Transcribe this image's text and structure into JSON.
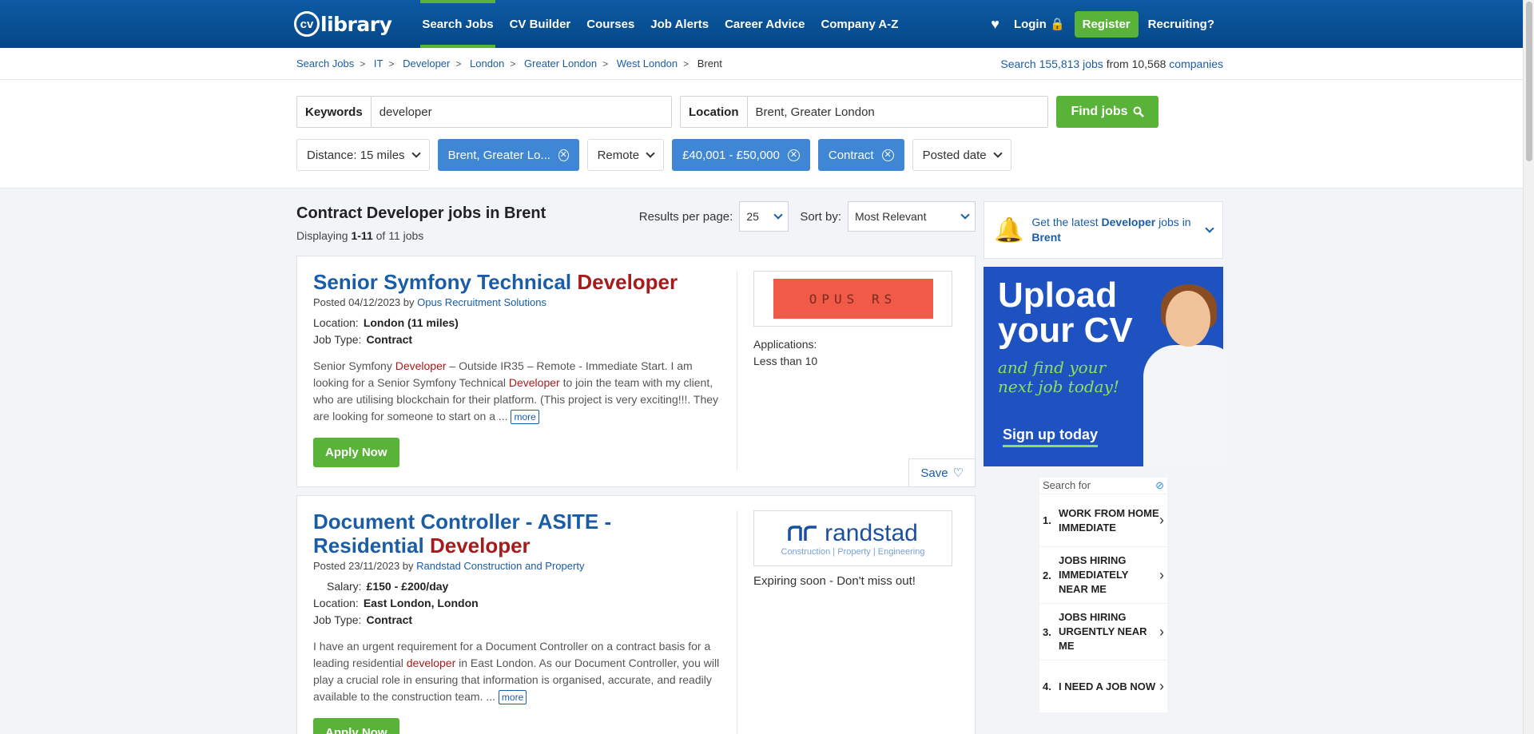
{
  "header": {
    "logo_cv": "cv",
    "logo_library": "library",
    "nav": [
      "Search Jobs",
      "CV Builder",
      "Courses",
      "Job Alerts",
      "Career Advice",
      "Company A-Z"
    ],
    "login": "Login",
    "register": "Register",
    "recruiting": "Recruiting?"
  },
  "breadcrumb": [
    "Search Jobs",
    "IT",
    "Developer",
    "London",
    "Greater London",
    "West London"
  ],
  "breadcrumb_current": "Brent",
  "stats": {
    "prefix": "Search",
    "jobs": "155,813 jobs",
    "from": "from 10,568",
    "companies": "companies"
  },
  "search": {
    "keywords_label": "Keywords",
    "keywords_value": "developer",
    "location_label": "Location",
    "location_value": "Brent, Greater London",
    "find_label": "Find jobs"
  },
  "filters": {
    "distance": "Distance: 15 miles",
    "location": "Brent, Greater Lo...",
    "remote": "Remote",
    "salary": "£40,001 - £50,000",
    "type": "Contract",
    "posted": "Posted date"
  },
  "results": {
    "title": "Contract Developer jobs in Brent",
    "displaying": "Displaying",
    "range": "1-11",
    "of": "of 11 jobs",
    "per_page_label": "Results per page:",
    "per_page": "25",
    "sort_label": "Sort by:",
    "sort": "Most Relevant"
  },
  "jobs": [
    {
      "title_a": "Senior Symfony Technical",
      "title_hl": "Developer",
      "posted": "Posted 04/12/2023 by",
      "company": "Opus Recruitment Solutions",
      "location_label": "Location:",
      "location": "London (11 miles)",
      "type_label": "Job Type:",
      "type": "Contract",
      "desc_1": "Senior Symfony",
      "desc_hl1": "Developer",
      "desc_2": " – Outside IR35 – Remote - Immediate Start. I am looking for a Senior Symfony Technical",
      "desc_hl2": "Developer",
      "desc_3": " to join the team with my client, who are utilising blockchain for their platform. (This project is very exciting!!!. They are looking for someone to start on a ...",
      "more": "more",
      "apply": "Apply Now",
      "logo": "OPUS RS",
      "applications_label": "Applications:",
      "applications": "Less than 10",
      "save": "Save"
    },
    {
      "title_a": "Document Controller - ASITE - Residential",
      "title_hl": "Developer",
      "posted": "Posted 23/11/2023 by",
      "company": "Randstad Construction and Property",
      "salary_label": "Salary:",
      "salary": "£150 - £200/day",
      "location_label": "Location:",
      "location": "East London, London",
      "type_label": "Job Type:",
      "type": "Contract",
      "desc_1": "I have an urgent requirement for a Document Controller on a contract basis for a leading residential",
      "desc_hl1": "developer",
      "desc_2": " in East London. As our Document Controller, you will play a crucial role in ensuring that information is organised, accurate, and readily available to the construction team. ...",
      "more": "more",
      "apply": "Apply Now",
      "logo": "randstad",
      "logo_sub": "Construction | Property | Engineering",
      "expiring": "Expiring soon - Don't miss out!"
    }
  ],
  "alert": {
    "a": "Get the latest",
    "b": "Developer",
    "c": "jobs in",
    "d": "Brent"
  },
  "ad": {
    "l1": "Upload",
    "l2": "your CV",
    "l3": "and find your",
    "l4": "next job today!",
    "cta": "Sign up today"
  },
  "gsearch": {
    "header": "Search for",
    "items": [
      {
        "n": "1.",
        "t": "WORK FROM HOME IMMEDIATE"
      },
      {
        "n": "2.",
        "t": "JOBS HIRING IMMEDIATELY NEAR ME"
      },
      {
        "n": "3.",
        "t": "JOBS HIRING URGENTLY NEAR ME"
      },
      {
        "n": "4.",
        "t": "I NEED A JOB NOW"
      }
    ]
  },
  "colors": {
    "header": "#0c5aa3",
    "green": "#5ab339",
    "link": "#1a5da6",
    "chip_selected": "#3f86d4",
    "highlight": "#a51c1c"
  }
}
